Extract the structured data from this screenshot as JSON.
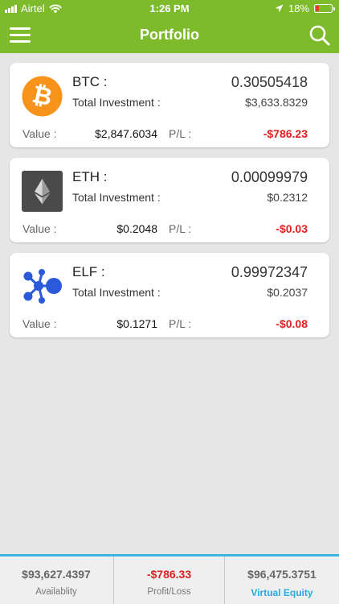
{
  "status_bar": {
    "carrier": "Airtel",
    "time": "1:26 PM",
    "battery": "18%"
  },
  "header": {
    "title": "Portfolio",
    "menu_icon": "hamburger-menu-icon",
    "search_icon": "search-icon"
  },
  "holdings": [
    {
      "symbol": "BTC :",
      "icon": "bitcoin-logo",
      "quantity": "0.30505418",
      "total_investment_label": "Total Investment :",
      "total_investment": "$3,633.8329",
      "value_label": "Value :",
      "value": "$2,847.6034",
      "pl_label": "P/L :",
      "pl": "-$786.23"
    },
    {
      "symbol": "ETH :",
      "icon": "ethereum-logo",
      "quantity": "0.00099979",
      "total_investment_label": "Total Investment :",
      "total_investment": "$0.2312",
      "value_label": "Value :",
      "value": "$0.2048",
      "pl_label": "P/L :",
      "pl": "-$0.03"
    },
    {
      "symbol": "ELF :",
      "icon": "aelf-logo",
      "quantity": "0.99972347",
      "total_investment_label": "Total Investment :",
      "total_investment": "$0.2037",
      "value_label": "Value :",
      "value": "$0.1271",
      "pl_label": "P/L :",
      "pl": "-$0.08"
    }
  ],
  "footer": {
    "items": [
      {
        "value": "$93,627.4397",
        "label": "Availablity"
      },
      {
        "value": "-$786.33",
        "label": "Profit/Loss"
      },
      {
        "value": "$96,475.3751",
        "label": "Virtual Equity"
      }
    ]
  },
  "colors": {
    "brand_green": "#7dbb2c",
    "loss_red": "#e02020",
    "accent_blue": "#3db5e0",
    "bitcoin_orange": "#f7931a",
    "aelf_blue": "#2a5ada"
  }
}
